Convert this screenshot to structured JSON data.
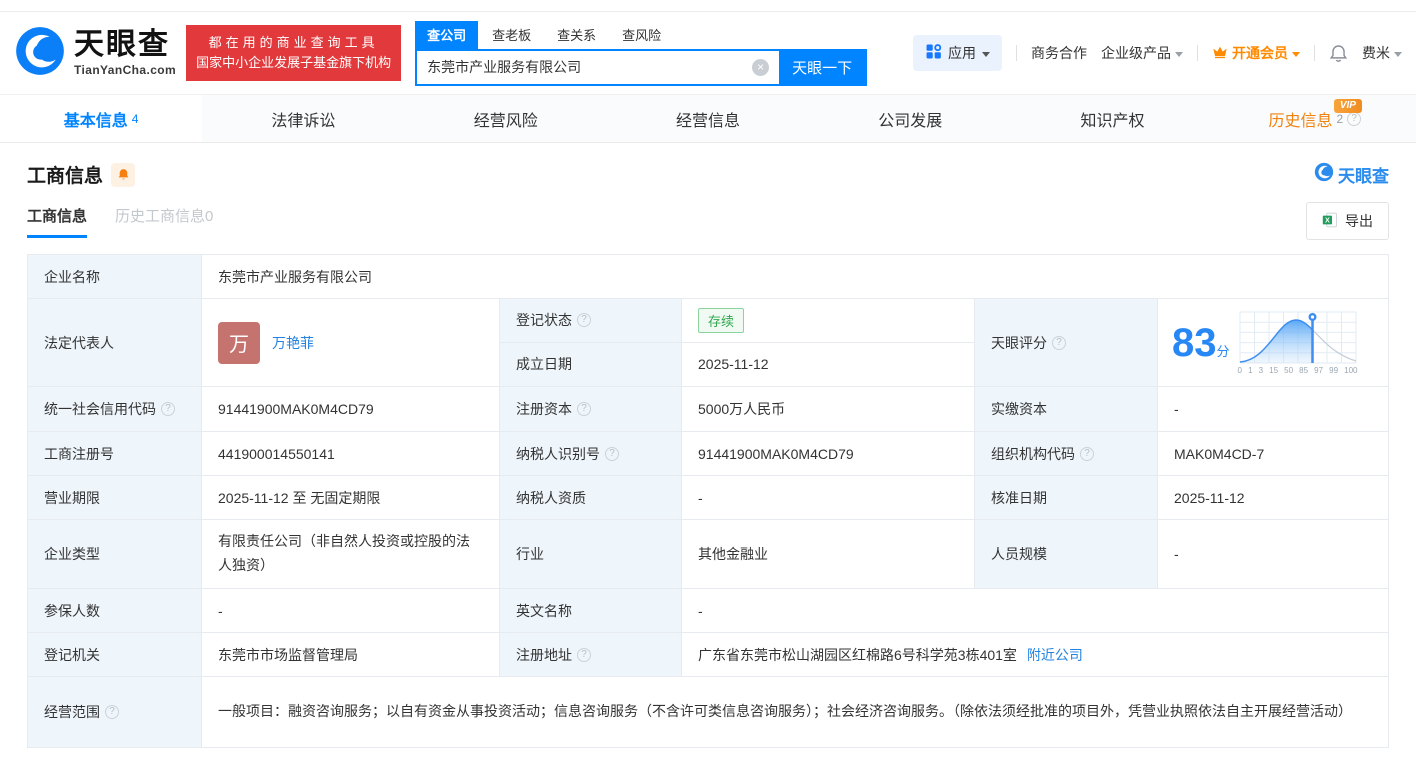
{
  "colors": {
    "accent_blue": "#0084ff",
    "banner_red": "#e23a3c",
    "vip_orange": "#ff8a00",
    "status_green": "#2fa84f",
    "avatar_red": "#c5736e",
    "score_blue": "#2787f5",
    "label_cell_bg": "#eef5fb"
  },
  "brand": {
    "name": "天眼查",
    "domain": "TianYanCha.com",
    "slogan_line1": "都在用的商业查询工具",
    "slogan_line2": "国家中小企业发展子基金旗下机构"
  },
  "search": {
    "tabs": [
      "查公司",
      "查老板",
      "查关系",
      "查风险"
    ],
    "value": "东莞市产业服务有限公司",
    "button": "天眼一下"
  },
  "top_nav": {
    "apps": "应用",
    "cooperation": "商务合作",
    "enterprise": "企业级产品",
    "vip": "开通会员",
    "username": "费米"
  },
  "main_tabs": [
    {
      "label": "基本信息",
      "count": "4"
    },
    {
      "label": "法律诉讼"
    },
    {
      "label": "经营风险"
    },
    {
      "label": "经营信息"
    },
    {
      "label": "公司发展"
    },
    {
      "label": "知识产权"
    },
    {
      "label": "历史信息",
      "count": "2",
      "vip": "VIP"
    }
  ],
  "section": {
    "title": "工商信息",
    "watermark": "天眼查",
    "subtab_current": "工商信息",
    "subtab_history": "历史工商信息0",
    "export_label": "导出"
  },
  "score": {
    "label": "天眼评分",
    "value": "83",
    "unit": "分",
    "axis": [
      "0",
      "1",
      "3",
      "15",
      "50",
      "85",
      "97",
      "99",
      "100"
    ]
  },
  "fields": {
    "company_name": {
      "label": "企业名称",
      "value": "东莞市产业服务有限公司"
    },
    "legal_rep": {
      "label": "法定代表人",
      "avatar": "万",
      "name": "万艳菲"
    },
    "reg_status": {
      "label": "登记状态",
      "value": "存续"
    },
    "est_date": {
      "label": "成立日期",
      "value": "2025-11-12"
    },
    "credit_code": {
      "label": "统一社会信用代码",
      "value": "91441900MAK0M4CD79"
    },
    "reg_capital": {
      "label": "注册资本",
      "value": "5000万人民币"
    },
    "paid_capital": {
      "label": "实缴资本",
      "value": "-"
    },
    "reg_number": {
      "label": "工商注册号",
      "value": "441900014550141"
    },
    "taxpayer_id": {
      "label": "纳税人识别号",
      "value": "91441900MAK0M4CD79"
    },
    "org_code": {
      "label": "组织机构代码",
      "value": "MAK0M4CD-7"
    },
    "business_term": {
      "label": "营业期限",
      "value": "2025-11-12 至 无固定期限"
    },
    "taxpayer_quality": {
      "label": "纳税人资质",
      "value": "-"
    },
    "approval_date": {
      "label": "核准日期",
      "value": "2025-11-12"
    },
    "company_type": {
      "label": "企业类型",
      "value": "有限责任公司（非自然人投资或控股的法人独资）"
    },
    "industry": {
      "label": "行业",
      "value": "其他金融业"
    },
    "staff_size": {
      "label": "人员规模",
      "value": "-"
    },
    "insured_count": {
      "label": "参保人数",
      "value": "-"
    },
    "english_name": {
      "label": "英文名称",
      "value": "-"
    },
    "reg_authority": {
      "label": "登记机关",
      "value": "东莞市市场监督管理局"
    },
    "reg_address": {
      "label": "注册地址",
      "value": "广东省东莞市松山湖园区红棉路6号科学苑3栋401室",
      "link": "附近公司"
    },
    "business_scope": {
      "label": "经营范围",
      "value": "一般项目：融资咨询服务；以自有资金从事投资活动；信息咨询服务（不含许可类信息咨询服务）；社会经济咨询服务。（除依法须经批准的项目外，凭营业执照依法自主开展经营活动）"
    }
  }
}
